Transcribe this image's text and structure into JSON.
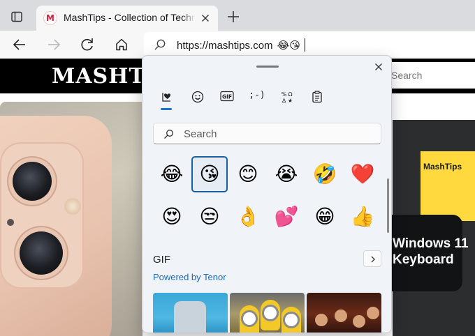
{
  "browser": {
    "tab": {
      "favicon_letter": "M",
      "title": "MashTips - Collection of Technical Tips"
    },
    "address_bar": {
      "url": "https://mashtips.com",
      "inserted_emojis": "😂😘"
    },
    "icons": {
      "tab_actions": "tab-actions-icon",
      "close_tab": "close-icon",
      "new_tab": "plus-icon",
      "back": "arrow-left-icon",
      "forward": "arrow-right-icon",
      "refresh": "refresh-icon",
      "home": "home-icon",
      "search": "search-icon"
    }
  },
  "webpage": {
    "logo_text": "MASHTIPS",
    "search_placeholder": "Search",
    "sticky_note": "MashTips",
    "promo_text": "Windows 11 Keyboard",
    "colors": {
      "header": "#000000",
      "sticky": "#ffd93d"
    }
  },
  "emoji_panel": {
    "category_tabs": [
      {
        "name": "recently-used",
        "icon": "heart-clock-icon",
        "active": true
      },
      {
        "name": "emoji",
        "icon": "smiley-icon",
        "active": false
      },
      {
        "name": "gif",
        "label": "GIF",
        "active": false
      },
      {
        "name": "kaomoji",
        "label": ";-)",
        "active": false
      },
      {
        "name": "symbols",
        "icon": "symbols-icon",
        "active": false
      },
      {
        "name": "clipboard",
        "icon": "clipboard-icon",
        "active": false
      }
    ],
    "search_placeholder": "Search",
    "emoji_grid": [
      {
        "glyph": "😂",
        "name": "face-with-tears-of-joy"
      },
      {
        "glyph": "😘",
        "name": "face-blowing-a-kiss",
        "selected": true
      },
      {
        "glyph": "😊",
        "name": "smiling-face"
      },
      {
        "glyph": "😭",
        "name": "loudly-crying-face"
      },
      {
        "glyph": "🤣",
        "name": "rolling-on-the-floor-laughing"
      },
      {
        "glyph": "❤️",
        "name": "red-heart"
      },
      {
        "glyph": "😍",
        "name": "smiling-face-with-heart-eyes"
      },
      {
        "glyph": "😒",
        "name": "unamused-face"
      },
      {
        "glyph": "👌",
        "name": "ok-hand"
      },
      {
        "glyph": "💕",
        "name": "two-hearts"
      },
      {
        "glyph": "😁",
        "name": "beaming-face"
      },
      {
        "glyph": "👍",
        "name": "thumbs-up"
      }
    ],
    "gif_section": {
      "title": "GIF",
      "powered_by": "Powered by Tenor"
    },
    "colors": {
      "accent": "#1a73c8",
      "panel_bg": "#f0f3f7"
    }
  }
}
